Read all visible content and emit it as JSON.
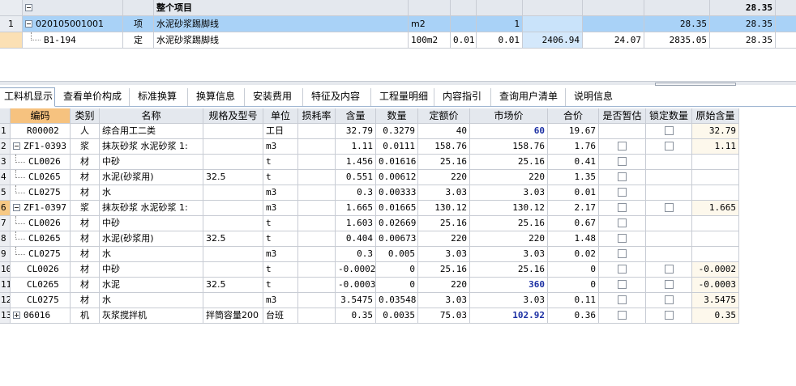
{
  "top_grid": {
    "header": {
      "section_title": "整个项目",
      "total": "28.35"
    },
    "rows": [
      {
        "num": "1",
        "code": "020105001001",
        "type": "项",
        "name": "水泥砂浆踢脚线",
        "unit": "m2",
        "qty": "1",
        "value1": "28.35",
        "value2": "28.35"
      },
      {
        "num": "",
        "code": "B1-194",
        "type": "定",
        "name": "水泥砂浆踢脚线",
        "unit": "100m2",
        "qty_a": "0.01",
        "qty_b": "0.01",
        "c1": "2406.94",
        "c2": "24.07",
        "c3": "2835.05",
        "c4": "28.35"
      }
    ]
  },
  "tabs": [
    {
      "label": "工料机显示",
      "active": true
    },
    {
      "label": "查看单价构成"
    },
    {
      "label": "标准换算"
    },
    {
      "label": "换算信息"
    },
    {
      "label": "安装费用"
    },
    {
      "label": "特征及内容"
    },
    {
      "label": "工程量明细"
    },
    {
      "label": "内容指引"
    },
    {
      "label": "查询用户清单"
    },
    {
      "label": "说明信息"
    }
  ],
  "columns": [
    "编码",
    "类别",
    "名称",
    "规格及型号",
    "单位",
    "损耗率",
    "含量",
    "数量",
    "定额价",
    "市场价",
    "合价",
    "是否暂估",
    "锁定数量",
    "原始含量"
  ],
  "rows": [
    {
      "num": "1",
      "code": "R00002",
      "cat": "人",
      "name": "综合用工二类",
      "spec": "",
      "unit": "工日",
      "loss": "",
      "content": "32.79",
      "qty": "0.3279",
      "price": "40",
      "market": "60",
      "market_blue": true,
      "total": "19.67",
      "est": false,
      "lock": true,
      "orig": "32.79",
      "level": 0,
      "expander": ""
    },
    {
      "num": "2",
      "code": "ZF1-0393",
      "cat": "浆",
      "name": "抹灰砂浆 水泥砂浆 1:",
      "spec": "",
      "unit": "m3",
      "loss": "",
      "content": "1.11",
      "qty": "0.0111",
      "price": "158.76",
      "market": "158.76",
      "total": "1.76",
      "est": true,
      "lock": true,
      "orig": "1.11",
      "level": 0,
      "expander": "minus"
    },
    {
      "num": "3",
      "code": "CL0026",
      "cat": "材",
      "name": "中砂",
      "spec": "",
      "unit": "t",
      "loss": "",
      "content": "1.456",
      "qty": "0.01616",
      "price": "25.16",
      "market": "25.16",
      "total": "0.41",
      "est": true,
      "lock": false,
      "orig": "",
      "level": 1,
      "expander": ""
    },
    {
      "num": "4",
      "code": "CL0265",
      "cat": "材",
      "name": "水泥(砂浆用)",
      "spec": "32.5",
      "unit": "t",
      "loss": "",
      "content": "0.551",
      "qty": "0.00612",
      "price": "220",
      "market": "220",
      "total": "1.35",
      "est": true,
      "lock": false,
      "orig": "",
      "level": 1,
      "expander": ""
    },
    {
      "num": "5",
      "code": "CL0275",
      "cat": "材",
      "name": "水",
      "spec": "",
      "unit": "m3",
      "loss": "",
      "content": "0.3",
      "qty": "0.00333",
      "price": "3.03",
      "market": "3.03",
      "total": "0.01",
      "est": true,
      "lock": false,
      "orig": "",
      "level": 1,
      "expander": ""
    },
    {
      "num": "6",
      "code": "ZF1-0397",
      "cat": "浆",
      "name": "抹灰砂浆 水泥砂浆 1:",
      "spec": "",
      "unit": "m3",
      "loss": "",
      "content": "1.665",
      "qty": "0.01665",
      "price": "130.12",
      "market": "130.12",
      "total": "2.17",
      "est": true,
      "lock": true,
      "orig": "1.665",
      "level": 0,
      "expander": "minus",
      "selected": true
    },
    {
      "num": "7",
      "code": "CL0026",
      "cat": "材",
      "name": "中砂",
      "spec": "",
      "unit": "t",
      "loss": "",
      "content": "1.603",
      "qty": "0.02669",
      "price": "25.16",
      "market": "25.16",
      "total": "0.67",
      "est": true,
      "lock": false,
      "orig": "",
      "level": 1,
      "expander": ""
    },
    {
      "num": "8",
      "code": "CL0265",
      "cat": "材",
      "name": "水泥(砂浆用)",
      "spec": "32.5",
      "unit": "t",
      "loss": "",
      "content": "0.404",
      "qty": "0.00673",
      "price": "220",
      "market": "220",
      "total": "1.48",
      "est": true,
      "lock": false,
      "orig": "",
      "level": 1,
      "expander": ""
    },
    {
      "num": "9",
      "code": "CL0275",
      "cat": "材",
      "name": "水",
      "spec": "",
      "unit": "m3",
      "loss": "",
      "content": "0.3",
      "qty": "0.005",
      "price": "3.03",
      "market": "3.03",
      "total": "0.02",
      "est": true,
      "lock": false,
      "orig": "",
      "level": 1,
      "expander": ""
    },
    {
      "num": "10",
      "code": "CL0026",
      "cat": "材",
      "name": "中砂",
      "spec": "",
      "unit": "t",
      "loss": "",
      "content": "-0.0002",
      "qty": "0",
      "price": "25.16",
      "market": "25.16",
      "total": "0",
      "est": true,
      "lock": true,
      "orig": "-0.0002",
      "level": 0,
      "expander": ""
    },
    {
      "num": "11",
      "code": "CL0265",
      "cat": "材",
      "name": "水泥",
      "spec": "32.5",
      "unit": "t",
      "loss": "",
      "content": "-0.0003",
      "qty": "0",
      "price": "220",
      "market": "360",
      "market_blue": true,
      "total": "0",
      "est": true,
      "lock": true,
      "orig": "-0.0003",
      "level": 0,
      "expander": ""
    },
    {
      "num": "12",
      "code": "CL0275",
      "cat": "材",
      "name": "水",
      "spec": "",
      "unit": "m3",
      "loss": "",
      "content": "3.5475",
      "qty": "0.03548",
      "price": "3.03",
      "market": "3.03",
      "total": "0.11",
      "est": true,
      "lock": true,
      "orig": "3.5475",
      "level": 0,
      "expander": ""
    },
    {
      "num": "13",
      "code": "06016",
      "cat": "机",
      "name": "灰浆搅拌机",
      "spec": "拌筒容量200",
      "unit": "台班",
      "loss": "",
      "content": "0.35",
      "qty": "0.0035",
      "price": "75.03",
      "market": "102.92",
      "market_blue": true,
      "total": "0.36",
      "est": true,
      "lock": true,
      "orig": "0.35",
      "level": 0,
      "expander": "plus"
    }
  ]
}
